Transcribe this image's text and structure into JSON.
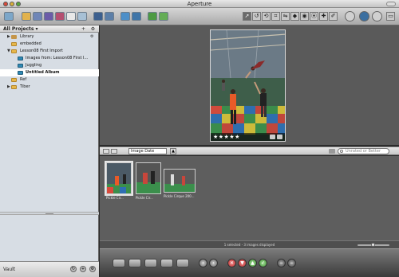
{
  "window": {
    "title": "Aperture"
  },
  "projects_panel": {
    "header": "All Projects ▾",
    "add_button": "+",
    "action_button": "⚙",
    "items": [
      {
        "label": "Library",
        "icon": "library-icon",
        "level": 0,
        "expanded": false
      },
      {
        "label": "embedded",
        "icon": "project-icon",
        "level": 0
      },
      {
        "label": "Lesson08 First Import",
        "icon": "project-icon",
        "level": 0,
        "expanded": true
      },
      {
        "label": "Images from: Lesson08 First I...",
        "icon": "album-icon",
        "level": 1
      },
      {
        "label": "Juggling",
        "icon": "album-icon",
        "level": 1
      },
      {
        "label": "Untitled Album",
        "icon": "album-icon",
        "level": 1,
        "selected": true
      },
      {
        "label": "Ref",
        "icon": "project-icon",
        "level": 0
      },
      {
        "label": "Tiber",
        "icon": "project-icon",
        "level": 0,
        "expanded": false
      }
    ]
  },
  "vault": {
    "label": "Vault"
  },
  "viewer": {
    "rating_stars": "★★★★★"
  },
  "browser_toolbar": {
    "sort_value": "Image Date",
    "search_placeholder": "Unrated or Better"
  },
  "thumbnails": [
    {
      "caption": "Pickle Cir...",
      "selected": true
    },
    {
      "caption": "Pickle Cir...",
      "selected": false
    },
    {
      "caption": "Pickle Cirque 200...",
      "selected": false
    }
  ],
  "status": {
    "text": "1 selected - 3 images displayed"
  },
  "colors": {
    "selection": "#ffffff",
    "panel": "#d7dde4",
    "viewer_bg": "#5a5a5a"
  }
}
